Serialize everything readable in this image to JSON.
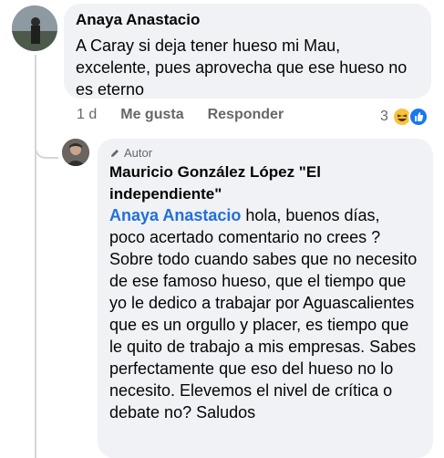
{
  "comment1": {
    "author": "Anaya Anastacio",
    "text": "A Caray si deja tener hueso mi Mau,\nexcelente, pues aprovecha que ese hueso no\nes eterno",
    "time": "1 d",
    "like_label": "Me gusta",
    "reply_label": "Responder",
    "reaction_count": "3"
  },
  "reply": {
    "badge": "Autor",
    "author": "Mauricio González López \"El independiente\"",
    "mention": "Anaya Anastacio",
    "text": " hola, buenos días, poco acertado comentario no crees ? Sobre todo cuando sabes que no necesito de ese famoso hueso, que el tiempo que yo le dedico a trabajar por Aguascalientes que es un orgullo y placer, es tiempo que le quito de trabajo a mis empresas. Sabes perfectamente que eso del hueso no lo necesito. Elevemos el nivel de crítica o debate no? Saludos"
  },
  "colors": {
    "bubble": "#f0f2f5",
    "link": "#216fdb",
    "meta": "#65676b"
  }
}
